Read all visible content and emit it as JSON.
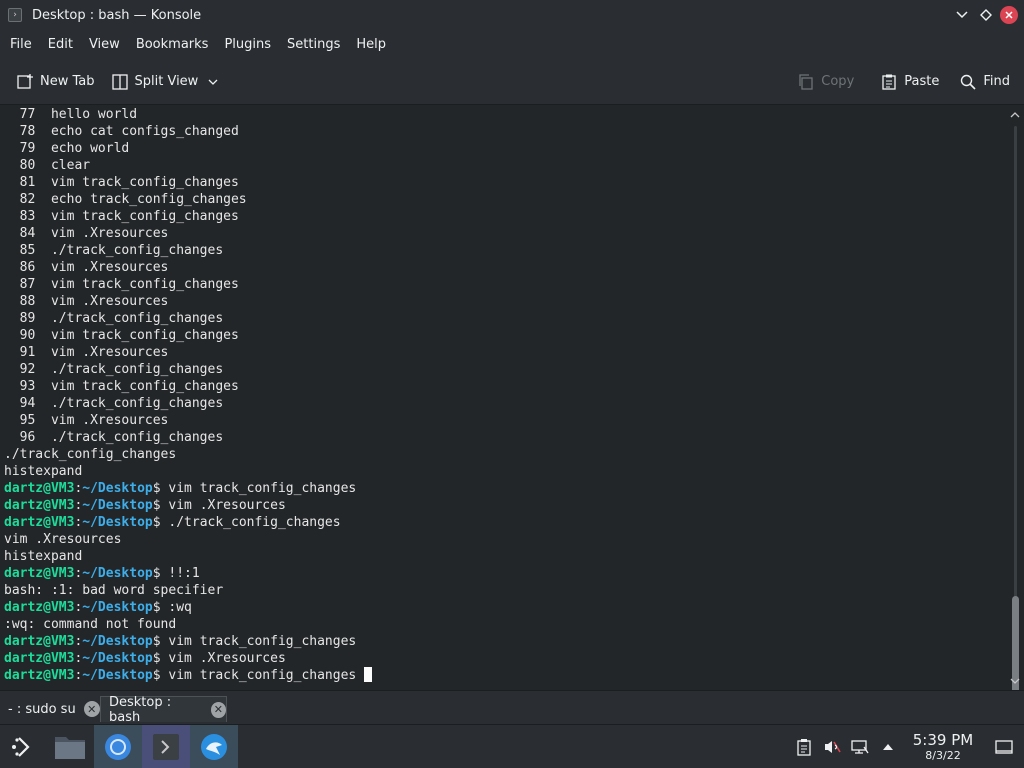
{
  "window": {
    "title": "Desktop : bash — Konsole",
    "buttons": {
      "minimize": "∨",
      "maximize": "◇",
      "close": "✕"
    }
  },
  "menu": [
    "File",
    "Edit",
    "View",
    "Bookmarks",
    "Plugins",
    "Settings",
    "Help"
  ],
  "toolbar": {
    "new_tab": "New Tab",
    "split_view": "Split View",
    "copy": "Copy",
    "paste": "Paste",
    "find": "Find"
  },
  "terminal": {
    "history": [
      {
        "n": "77",
        "cmd": "hello world"
      },
      {
        "n": "78",
        "cmd": "echo cat configs_changed"
      },
      {
        "n": "79",
        "cmd": "echo world"
      },
      {
        "n": "80",
        "cmd": "clear"
      },
      {
        "n": "81",
        "cmd": "vim track_config_changes"
      },
      {
        "n": "82",
        "cmd": "echo track_config_changes"
      },
      {
        "n": "83",
        "cmd": "vim track_config_changes"
      },
      {
        "n": "84",
        "cmd": "vim .Xresources"
      },
      {
        "n": "85",
        "cmd": "./track_config_changes"
      },
      {
        "n": "86",
        "cmd": "vim .Xresources"
      },
      {
        "n": "87",
        "cmd": "vim track_config_changes"
      },
      {
        "n": "88",
        "cmd": "vim .Xresources"
      },
      {
        "n": "89",
        "cmd": "./track_config_changes"
      },
      {
        "n": "90",
        "cmd": "vim track_config_changes"
      },
      {
        "n": "91",
        "cmd": "vim .Xresources"
      },
      {
        "n": "92",
        "cmd": "./track_config_changes"
      },
      {
        "n": "93",
        "cmd": "vim track_config_changes"
      },
      {
        "n": "94",
        "cmd": "./track_config_changes"
      },
      {
        "n": "95",
        "cmd": "vim .Xresources"
      },
      {
        "n": "96",
        "cmd": "./track_config_changes"
      }
    ],
    "prompt_user": "dartz@VM3",
    "prompt_path": "~/Desktop",
    "lines": [
      {
        "type": "out",
        "text": "./track_config_changes"
      },
      {
        "type": "out",
        "text": "histexpand"
      },
      {
        "type": "prompt",
        "text": "vim track_config_changes"
      },
      {
        "type": "prompt",
        "text": "vim .Xresources"
      },
      {
        "type": "prompt",
        "text": "./track_config_changes"
      },
      {
        "type": "out",
        "text": "vim .Xresources"
      },
      {
        "type": "out",
        "text": "histexpand"
      },
      {
        "type": "prompt",
        "text": "!!:1"
      },
      {
        "type": "out",
        "text": "bash: :1: bad word specifier"
      },
      {
        "type": "prompt",
        "text": ":wq"
      },
      {
        "type": "out",
        "text": ":wq: command not found"
      },
      {
        "type": "prompt",
        "text": "vim track_config_changes"
      },
      {
        "type": "prompt",
        "text": "vim .Xresources"
      },
      {
        "type": "prompt",
        "text": "vim track_config_changes ",
        "cursor": true
      }
    ]
  },
  "tabs": [
    {
      "label": "- : sudo su",
      "active": false
    },
    {
      "label": "Desktop : bash",
      "active": true
    }
  ],
  "taskbar": {
    "clock_time": "5:39 PM",
    "clock_date": "8/3/22"
  },
  "colors": {
    "background": "#232629",
    "prompt_user": "#1cdc9a",
    "prompt_path": "#3daee9",
    "close_button": "#da4453"
  }
}
